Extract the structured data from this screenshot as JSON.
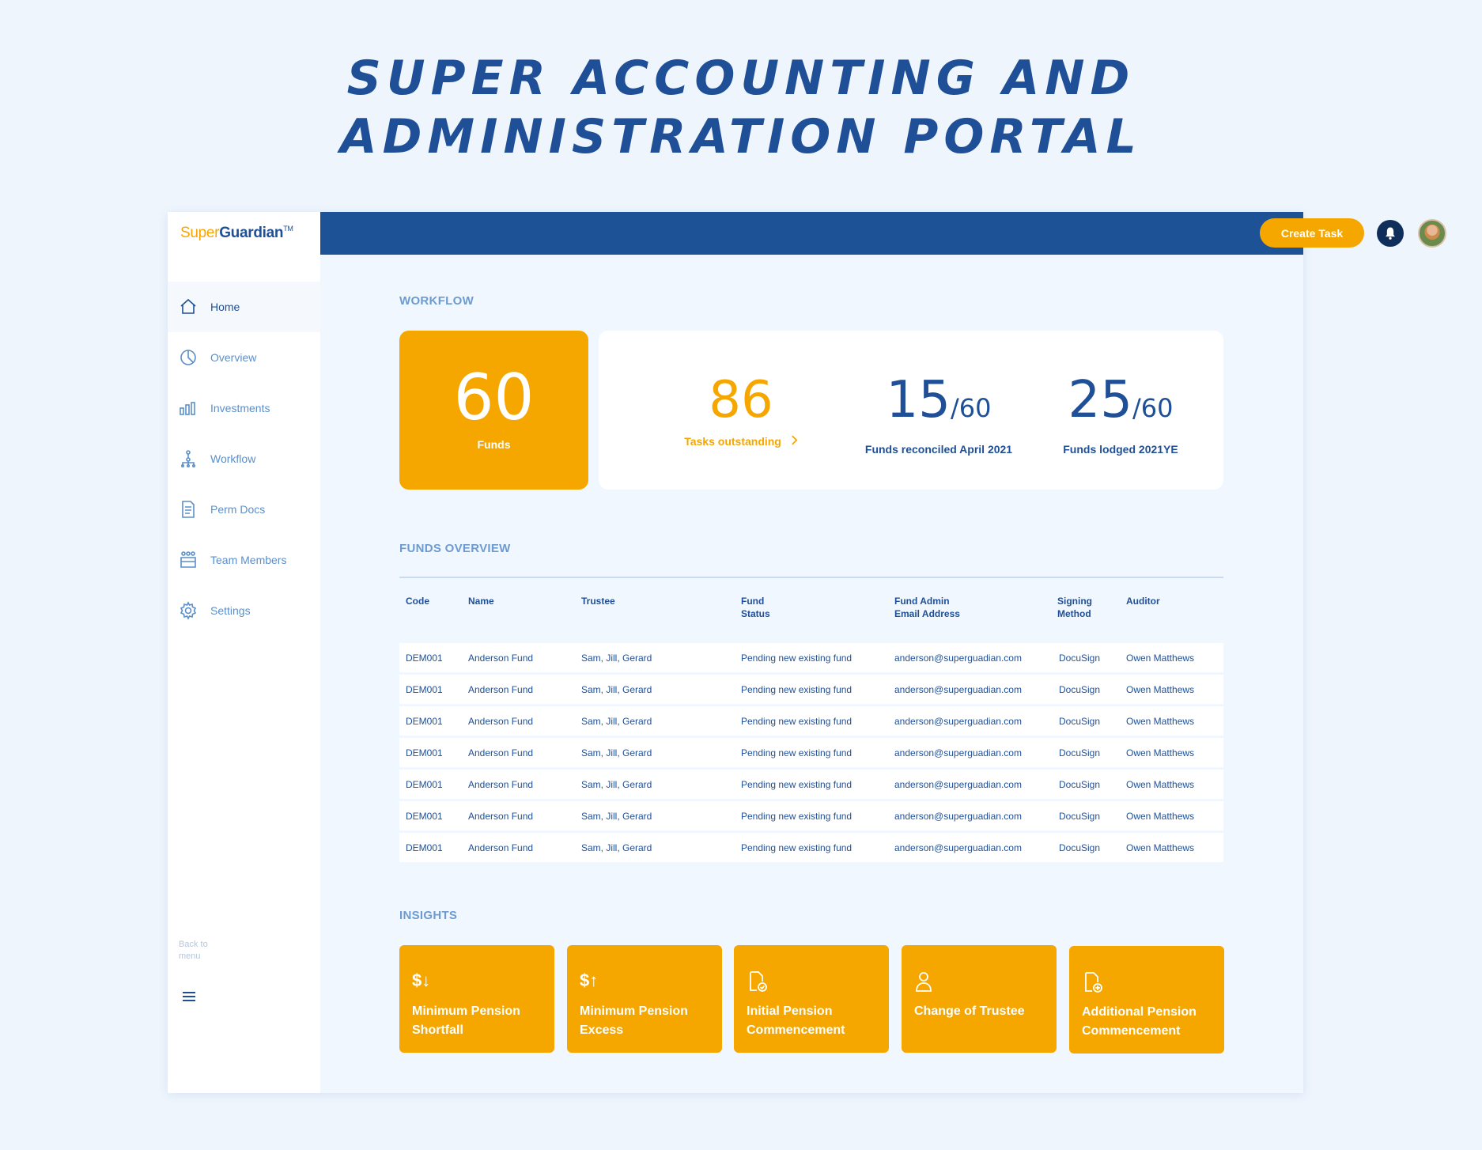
{
  "hero": {
    "line1": "SUPER ACCOUNTING AND",
    "line2": "ADMINISTRATION PORTAL"
  },
  "brand": {
    "part1": "Super",
    "part2": "Guardian",
    "tm": "TM"
  },
  "nav": [
    {
      "label": "Home",
      "icon": "home-icon"
    },
    {
      "label": "Overview",
      "icon": "pie-chart-icon"
    },
    {
      "label": "Investments",
      "icon": "bar-chart-icon"
    },
    {
      "label": "Workflow",
      "icon": "workflow-icon"
    },
    {
      "label": "Perm Docs",
      "icon": "document-icon"
    },
    {
      "label": "Team Members",
      "icon": "team-icon"
    },
    {
      "label": "Settings",
      "icon": "gear-icon"
    }
  ],
  "sidebar_footer": {
    "back_label": "Back to menu"
  },
  "topbar": {
    "create_task": "Create Task"
  },
  "workflow": {
    "title": "WORKFLOW",
    "funds": {
      "value": "60",
      "label": "Funds"
    },
    "tasks": {
      "value": "86",
      "label": "Tasks outstanding"
    },
    "reconciled": {
      "value": "15",
      "denominator": "/60",
      "label": "Funds reconciled April 2021"
    },
    "lodged": {
      "value": "25",
      "denominator": "/60",
      "label": "Funds lodged 2021YE"
    }
  },
  "funds_overview": {
    "title": "FUNDS OVERVIEW",
    "columns": [
      "Code",
      "Name",
      "Trustee",
      "Fund",
      "Status",
      "Fund Admin",
      "Email Address",
      "Signing",
      "Method",
      "Auditor"
    ],
    "rows": [
      [
        "DEM001",
        "Anderson Fund",
        "Sam, Jill, Gerard",
        "Pending new existing fund",
        "anderson@superguadian.com",
        "DocuSign",
        "Owen Matthews"
      ],
      [
        "DEM001",
        "Anderson Fund",
        "Sam, Jill, Gerard",
        "Pending new existing fund",
        "anderson@superguadian.com",
        "DocuSign",
        "Owen Matthews"
      ],
      [
        "DEM001",
        "Anderson Fund",
        "Sam, Jill, Gerard",
        "Pending new existing fund",
        "anderson@superguadian.com",
        "DocuSign",
        "Owen Matthews"
      ],
      [
        "DEM001",
        "Anderson Fund",
        "Sam, Jill, Gerard",
        "Pending new existing fund",
        "anderson@superguadian.com",
        "DocuSign",
        "Owen Matthews"
      ],
      [
        "DEM001",
        "Anderson Fund",
        "Sam, Jill, Gerard",
        "Pending new existing fund",
        "anderson@superguadian.com",
        "DocuSign",
        "Owen Matthews"
      ],
      [
        "DEM001",
        "Anderson Fund",
        "Sam, Jill, Gerard",
        "Pending new existing fund",
        "anderson@superguadian.com",
        "DocuSign",
        "Owen Matthews"
      ],
      [
        "DEM001",
        "Anderson Fund",
        "Sam, Jill, Gerard",
        "Pending new existing fund",
        "anderson@superguadian.com",
        "DocuSign",
        "Owen Matthews"
      ]
    ]
  },
  "insights": {
    "title": "INSIGHTS",
    "cards": [
      {
        "icon": "dollar-down-icon",
        "glyph": "$↓",
        "line1": "Minimum Pension",
        "line2": "Shortfall"
      },
      {
        "icon": "dollar-up-icon",
        "glyph": "$↑",
        "line1": "Minimum Pension",
        "line2": "Excess"
      },
      {
        "icon": "document-check-icon",
        "glyph": "",
        "line1": "Initial Pension",
        "line2": "Commencement"
      },
      {
        "icon": "person-icon",
        "glyph": "",
        "line1": "Change of Trustee",
        "line2": ""
      },
      {
        "icon": "document-plus-icon",
        "glyph": "",
        "line1": "Additional Pension",
        "line2": "Commencement"
      }
    ]
  },
  "colors": {
    "primary": "#1d5396",
    "accent": "#f5a700",
    "background": "#eef5fd"
  }
}
